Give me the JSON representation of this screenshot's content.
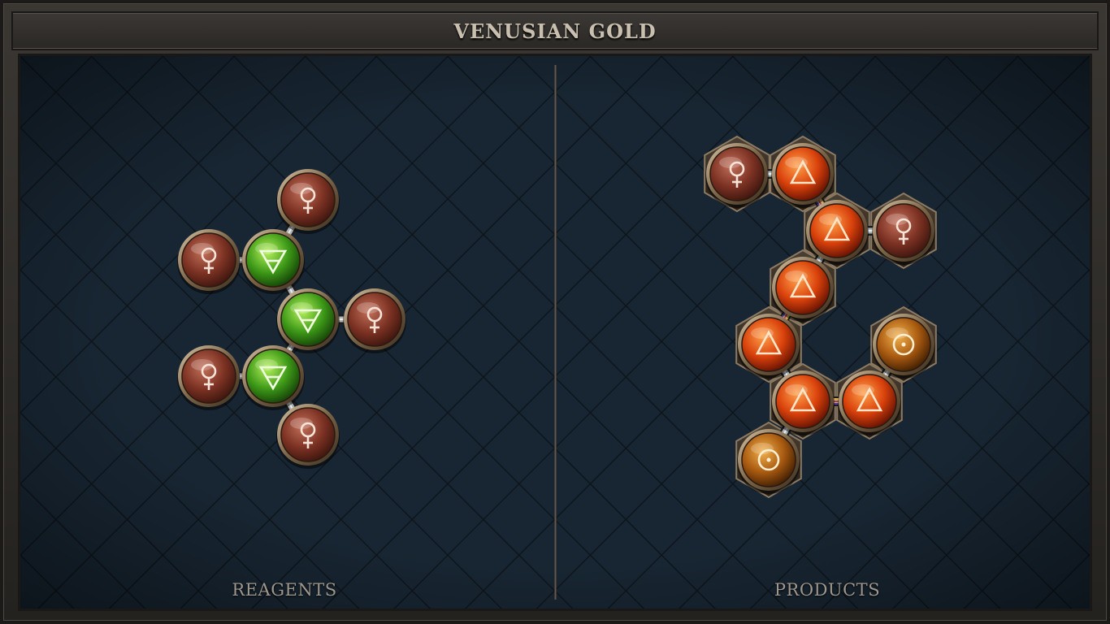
{
  "puzzle": {
    "title": "VENUSIAN GOLD"
  },
  "panels": {
    "reagents": {
      "label": "REAGENTS"
    },
    "products": {
      "label": "PRODUCTS"
    }
  },
  "atom_types": {
    "copper": {
      "symbol": "♀",
      "color": "#8a3a2a",
      "icon": "copper-symbol-icon"
    },
    "earth": {
      "symbol": "🜃",
      "color": "#3f9a1c",
      "icon": "earth-symbol-icon"
    },
    "fire": {
      "symbol": "△",
      "color": "#d8400c",
      "icon": "fire-symbol-icon"
    },
    "gold": {
      "symbol": "☉",
      "color": "#b8650e",
      "icon": "gold-symbol-icon"
    }
  },
  "reagent_molecule": {
    "atoms": [
      {
        "id": "c1",
        "type": "copper"
      },
      {
        "id": "c2",
        "type": "copper"
      },
      {
        "id": "c3",
        "type": "copper"
      },
      {
        "id": "c4",
        "type": "copper"
      },
      {
        "id": "c5",
        "type": "copper"
      },
      {
        "id": "e1",
        "type": "earth"
      },
      {
        "id": "e2",
        "type": "earth"
      },
      {
        "id": "e3",
        "type": "earth"
      }
    ],
    "bonds": [
      {
        "a": "c2",
        "b": "e1",
        "kind": "normal"
      },
      {
        "a": "c1",
        "b": "e1",
        "kind": "normal"
      },
      {
        "a": "e1",
        "b": "e2",
        "kind": "normal"
      },
      {
        "a": "e2",
        "b": "c3",
        "kind": "normal"
      },
      {
        "a": "e2",
        "b": "e3",
        "kind": "normal"
      },
      {
        "a": "c4",
        "b": "e3",
        "kind": "normal"
      },
      {
        "a": "e3",
        "b": "c5",
        "kind": "normal"
      }
    ]
  },
  "product_molecule": {
    "atoms": [
      {
        "id": "p_c1",
        "type": "copper"
      },
      {
        "id": "p_f1",
        "type": "fire"
      },
      {
        "id": "p_f2",
        "type": "fire"
      },
      {
        "id": "p_c2",
        "type": "copper"
      },
      {
        "id": "p_f3",
        "type": "fire"
      },
      {
        "id": "p_f4",
        "type": "fire"
      },
      {
        "id": "p_g1",
        "type": "gold"
      },
      {
        "id": "p_f5",
        "type": "fire"
      },
      {
        "id": "p_f6",
        "type": "fire"
      },
      {
        "id": "p_g2",
        "type": "gold"
      }
    ],
    "bonds": [
      {
        "a": "p_c1",
        "b": "p_f1",
        "kind": "normal"
      },
      {
        "a": "p_f1",
        "b": "p_f2",
        "kind": "triplex"
      },
      {
        "a": "p_f2",
        "b": "p_c2",
        "kind": "normal"
      },
      {
        "a": "p_f2",
        "b": "p_f3",
        "kind": "normal"
      },
      {
        "a": "p_f3",
        "b": "p_f4",
        "kind": "triplex"
      },
      {
        "a": "p_f4",
        "b": "p_f5",
        "kind": "normal"
      },
      {
        "a": "p_f5",
        "b": "p_f6",
        "kind": "triplex"
      },
      {
        "a": "p_f6",
        "b": "p_g1",
        "kind": "normal"
      },
      {
        "a": "p_f5",
        "b": "p_g2",
        "kind": "normal"
      }
    ]
  }
}
